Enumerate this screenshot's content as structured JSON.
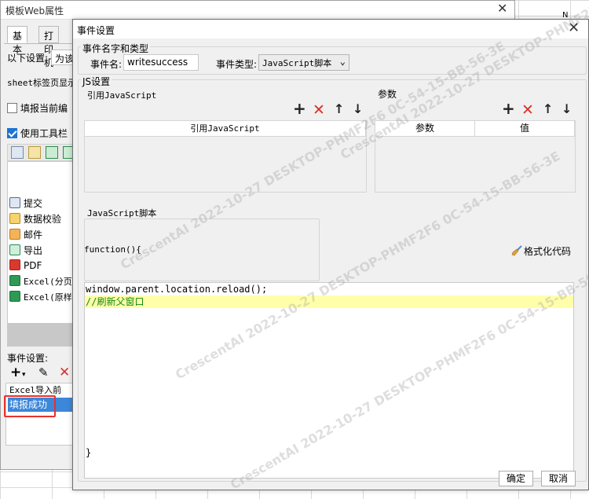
{
  "spreadsheet": {
    "column_label": "N"
  },
  "back_window": {
    "title": "模板Web属性",
    "close_glyph": "✕",
    "tabs": [
      "基本",
      "打印机"
    ],
    "row_settings_label": "以下设置:",
    "row_settings_select": "为该",
    "sheet_tab_label": "sheet标签页显示",
    "fill_current_label": "填报当前编",
    "use_toolbar_label": "使用工具栏",
    "list_items": [
      {
        "label": "提交",
        "icon": "save-icon"
      },
      {
        "label": "数据校验",
        "icon": "pencil-icon"
      },
      {
        "label": "邮件",
        "icon": "mail-icon"
      },
      {
        "label": "导出",
        "icon": "export-icon"
      },
      {
        "label": "PDF",
        "icon": "pdf-icon"
      },
      {
        "label": "Excel(分页",
        "icon": "excel-icon"
      },
      {
        "label": "Excel(原样",
        "icon": "excel-icon"
      }
    ],
    "event_settings_label": "事件设置:",
    "event_list": [
      {
        "label": "Excel导入前",
        "selected": false
      },
      {
        "label": "填报成功",
        "selected": true
      }
    ]
  },
  "dialog": {
    "title": "事件设置",
    "close_glyph": "✕",
    "section_name_title": "事件名字和类型",
    "event_name_label": "事件名:",
    "event_name_value": "writesuccess",
    "event_type_label": "事件类型:",
    "event_type_value": "JavaScript脚本",
    "js_section_title": "JS设置",
    "ref_js_title": "引用JavaScript",
    "params_title": "参数",
    "ref_table_header": "引用JavaScript",
    "params_table_headers": [
      "参数",
      "值"
    ],
    "script_title": "JavaScript脚本",
    "function_header": "function(){",
    "format_code_label": "格式化代码",
    "code_lines": [
      "window.parent.location.reload();",
      "//刷新父窗口"
    ],
    "closing_brace": "}",
    "ok_label": "确定",
    "cancel_label": "取消"
  },
  "watermark": {
    "lines": [
      "CrescentAI  2022-10-27  DESKTOP-PHMF2F6  0C-54-15-BB-56-3E",
      "CrescentAI  2022-10-27  DESKTOP-PHMF2F6  0C-54-15-BB-56-3E",
      "CrescentAI  2022-10-27  DESKTOP-PHMF2F6  0C-54-15-BB-56-3E",
      "CrescentAI  2022-10-27  DESKTOP-PHMF2F6  0C-54-15-BB-56-3E"
    ]
  }
}
